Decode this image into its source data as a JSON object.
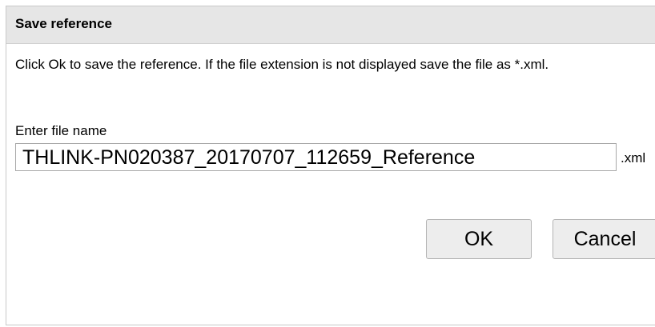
{
  "dialog": {
    "title": "Save reference",
    "message": "Click Ok to save the reference. If the file extension is not displayed save the file as *.xml.",
    "filename_label": "Enter file name",
    "filename_value": "THLINK-PN020387_20170707_112659_Reference",
    "extension": ".xml",
    "ok_label": "OK",
    "cancel_label": "Cancel"
  }
}
